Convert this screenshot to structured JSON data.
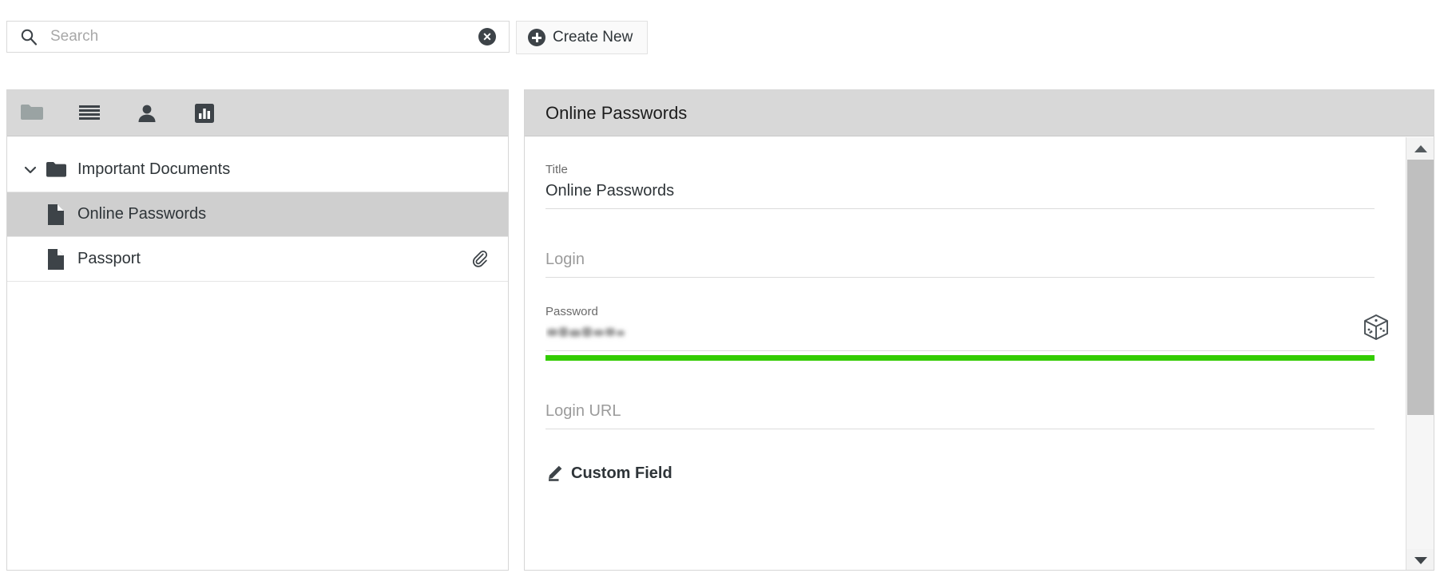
{
  "app": {
    "accent_dark": "#3d4348",
    "panel_header_bg": "#d8d8d8",
    "selection_bg": "#cfcfcf",
    "strength_color": "#33cc00"
  },
  "topbar": {
    "search": {
      "placeholder": "Search",
      "value": "",
      "icon": "search-icon",
      "clear_icon": "clear-circle-x-icon",
      "clear_glyph": "✕"
    },
    "create_button": {
      "label": "Create New",
      "icon": "plus-circle-icon"
    }
  },
  "sidebar": {
    "toolbar": [
      {
        "name": "folder-view",
        "icon": "folder-icon"
      },
      {
        "name": "list-view",
        "icon": "list-icon"
      },
      {
        "name": "identity-view",
        "icon": "person-icon"
      },
      {
        "name": "statistics-view",
        "icon": "bar-chart-icon"
      }
    ],
    "tree": [
      {
        "label": "Important Documents",
        "icon": "folder-icon",
        "expanded": true,
        "chevron": "chevron-down-icon",
        "level": 0,
        "selected": false,
        "attachment": false
      },
      {
        "label": "Online Passwords",
        "icon": "document-icon",
        "level": 1,
        "selected": true,
        "attachment": false
      },
      {
        "label": "Passport",
        "icon": "document-icon",
        "level": 1,
        "selected": false,
        "attachment": true,
        "attachment_icon": "paperclip-icon"
      }
    ]
  },
  "detail": {
    "header_title": "Online Passwords",
    "fields": {
      "title": {
        "label": "Title",
        "value": "Online Passwords"
      },
      "login": {
        "label": "Login",
        "value": ""
      },
      "password": {
        "label": "Password",
        "value": "",
        "masked": true,
        "strength_percent": 100,
        "generate_icon": "dice-icon"
      },
      "login_url": {
        "label": "Login URL",
        "value": ""
      }
    },
    "custom_field": {
      "label": "Custom Field",
      "icon": "pencil-icon"
    },
    "scrollbar": {
      "up_icon": "triangle-up-icon",
      "down_icon": "triangle-down-icon",
      "thumb_position_percent": 0,
      "thumb_size_percent": 65
    }
  }
}
